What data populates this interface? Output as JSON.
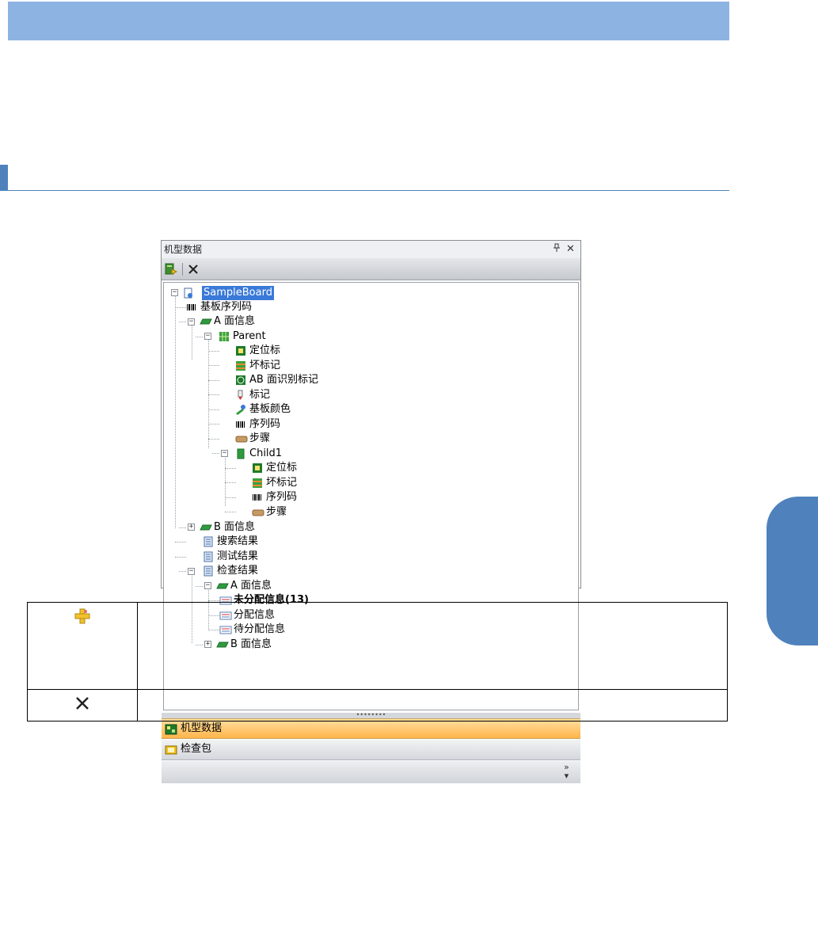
{
  "panel": {
    "title": "机型数据",
    "pin_glyph": "ᴾ",
    "close_glyph": "✕",
    "toolbar": {
      "add_icon": "add-model-icon",
      "delete_icon": "delete-icon"
    }
  },
  "tree": [
    {
      "id": "n0",
      "label": "SampleBoard",
      "icon": "board-file-icon",
      "selected": true
    },
    {
      "id": "n1",
      "label": "基板序列码",
      "icon": "barcode-icon"
    },
    {
      "id": "n2",
      "label": "A 面信息",
      "icon": "green-plate-icon"
    },
    {
      "id": "n3",
      "label": "Parent",
      "icon": "circuit-grid-icon"
    },
    {
      "id": "n4",
      "label": "定位标",
      "icon": "fiducial-icon"
    },
    {
      "id": "n5",
      "label": "坏标记",
      "icon": "bad-mark-icon"
    },
    {
      "id": "n6",
      "label": "AB 面识别标记",
      "icon": "ab-mark-icon"
    },
    {
      "id": "n7",
      "label": "标记",
      "icon": "pen-mark-icon"
    },
    {
      "id": "n8",
      "label": "基板颜色",
      "icon": "color-icon"
    },
    {
      "id": "n9",
      "label": "序列码",
      "icon": "barcode-icon"
    },
    {
      "id": "n10",
      "label": "步骤",
      "icon": "step-icon"
    },
    {
      "id": "n11",
      "label": "Child1",
      "icon": "child-board-icon"
    },
    {
      "id": "n12",
      "label": "定位标",
      "icon": "fiducial-icon"
    },
    {
      "id": "n13",
      "label": "坏标记",
      "icon": "bad-mark-icon"
    },
    {
      "id": "n14",
      "label": "序列码",
      "icon": "barcode-icon"
    },
    {
      "id": "n15",
      "label": "步骤",
      "icon": "step-icon"
    },
    {
      "id": "n16",
      "label": "B 面信息",
      "icon": "green-plate-icon"
    },
    {
      "id": "n17",
      "label": "搜索结果",
      "icon": "document-icon"
    },
    {
      "id": "n18",
      "label": "测试结果",
      "icon": "document-icon"
    },
    {
      "id": "n19",
      "label": "检查结果",
      "icon": "document-icon"
    },
    {
      "id": "n20",
      "label": "A 面信息",
      "icon": "green-plate-icon"
    },
    {
      "id": "n21",
      "label": "未分配信息(13)",
      "icon": "info-list-icon",
      "bold": true
    },
    {
      "id": "n22",
      "label": "分配信息",
      "icon": "info-list-icon"
    },
    {
      "id": "n23",
      "label": "待分配信息",
      "icon": "info-list-icon"
    },
    {
      "id": "n24",
      "label": "B 面信息",
      "icon": "green-plate-icon"
    }
  ],
  "splitter_grip": "••••••••",
  "tabs": [
    {
      "label": "机型数据",
      "icon": "model-data-icon",
      "active": true
    },
    {
      "label": "检查包",
      "icon": "inspection-package-icon",
      "active": false
    }
  ],
  "overflow_glyph": "»",
  "legend": [
    {
      "icon": "add-plus-icon",
      "description": ""
    },
    {
      "icon": "delete-icon",
      "description": ""
    }
  ],
  "colors": {
    "header_bar": "#8db3e2",
    "accent": "#4f81bd",
    "selection": "#3a79d8",
    "active_tab": "#ffb44a"
  }
}
